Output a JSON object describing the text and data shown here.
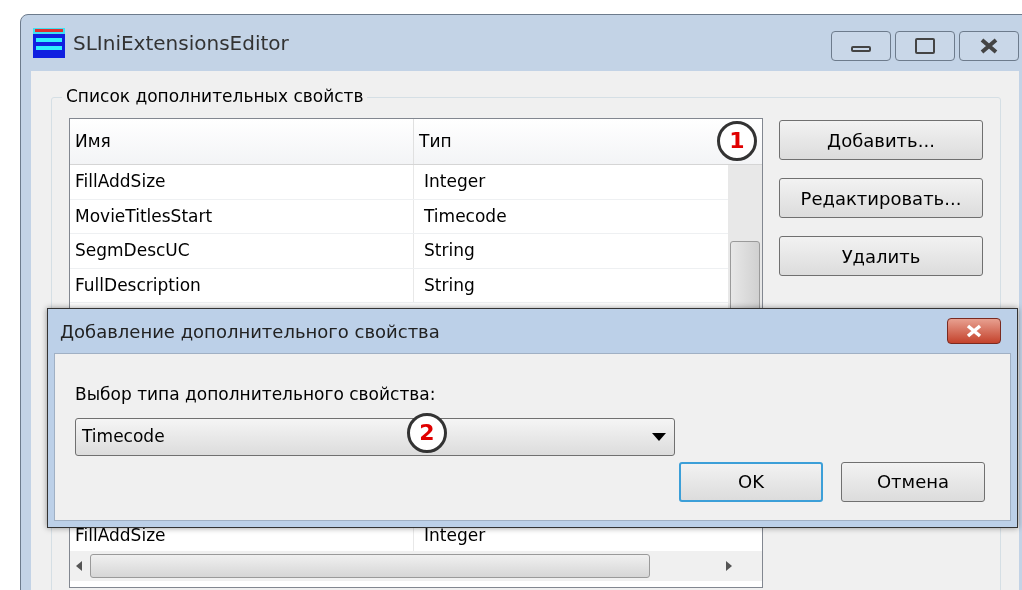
{
  "window": {
    "title": "SLIniExtensionsEditor"
  },
  "group": {
    "title": "Список дополнительных свойств"
  },
  "table": {
    "columns": [
      "Имя",
      "Тип"
    ],
    "rows": [
      {
        "name": "FillAddSize",
        "type": "Integer"
      },
      {
        "name": "MovieTitlesStart",
        "type": "Timecode"
      },
      {
        "name": "SegmDescUC",
        "type": "String"
      },
      {
        "name": "FullDescription",
        "type": "String"
      }
    ],
    "partial_row": {
      "name": "FillAddSize",
      "type": "Integer"
    }
  },
  "buttons": [
    "Добавить...",
    "Редактировать...",
    "Удалить"
  ],
  "callouts": [
    "1",
    "2"
  ],
  "dialog": {
    "title": "Добавление дополнительного свойства",
    "label": "Выбор типа дополнительного свойства:",
    "select": {
      "value": "Timecode"
    },
    "buttons": [
      {
        "label": "OK",
        "default": true
      },
      {
        "label": "Отмена",
        "default": false
      }
    ]
  }
}
